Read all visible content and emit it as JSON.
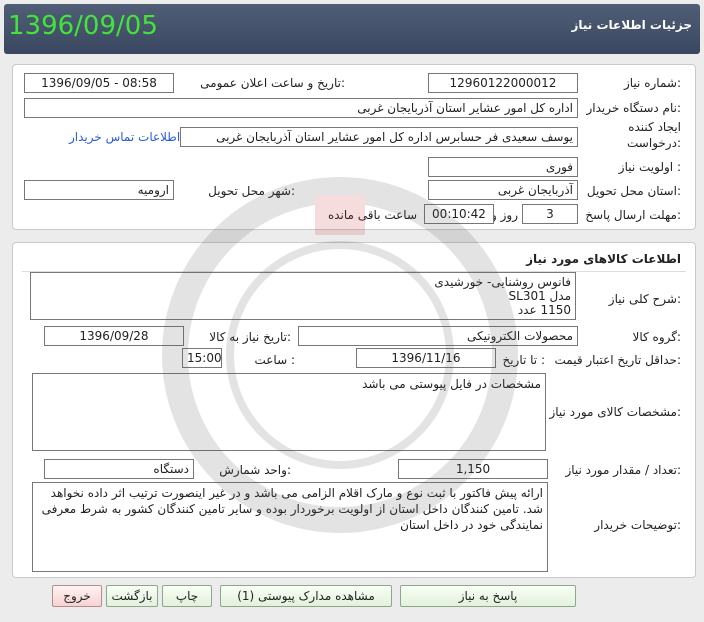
{
  "header": {
    "title": "جزئیات اطلاعات نیاز",
    "date": "1396/09/05"
  },
  "need_info": {
    "need_number_label": "شماره نیاز:",
    "need_number": "12960122000012",
    "announce_label": "تاریخ و ساعت اعلان عمومی:",
    "announce_value": "1396/09/05 - 08:58",
    "buyer_org_label": "نام دستگاه خریدار:",
    "buyer_org": "اداره کل امور عشایر استان آذربایجان غربی",
    "requester_label_1": "ایجاد کننده",
    "requester_label_2": "درخواست:",
    "requester": "یوسف سعیدی فر حسابرس اداره کل امور عشایر استان آذربایجان غربی",
    "contact_link": "اطلاعات تماس خریدار",
    "priority_label": "اولویت نیاز :",
    "priority": "فوری",
    "province_label": "استان محل تحویل:",
    "province": "آذربایجان غربی",
    "city_label": "شهر محل تحویل:",
    "city": "ارومیه",
    "deadline_label": "مهلت ارسال پاسخ:",
    "days": "3",
    "days_label": "روز و",
    "time_left": "00:10:42",
    "time_left_label": "ساعت باقی مانده"
  },
  "goods": {
    "section_title": "اطلاعات کالاهای مورد نیاز",
    "description_label": "شرح کلی نیاز:",
    "description_lines": [
      "فانوس روشنایی-   خورشیدی",
      "مدل SL301",
      "1150 عدد"
    ],
    "group_label": "گروه کالا:",
    "group": "محصولات الکترونیکی",
    "need_date_label": "تاریخ نیاز به کالا:",
    "need_date": "1396/09/28",
    "price_validity_label": "حداقل تاریخ اعتبار قیمت:",
    "until_date_label": "تا تاریخ :",
    "until_date": "1396/11/16",
    "hour_label": "ساعت :",
    "hour": "15:00",
    "specs_label": "مشخصات کالای مورد نیاز:",
    "specs": "مشخصات در فایل پیوستی می باشد",
    "quantity_label": "تعداد / مقدار مورد نیاز:",
    "quantity": "1,150",
    "unit_label": "واحد شمارش:",
    "unit": "دستگاه",
    "buyer_notes_label": "توضیحات خریدار:",
    "buyer_notes": "ارائه پیش فاکتور با ثبت نوع و مارک اقلام  الزامی می باشد و در غیر اینصورت ترتیب اثر داده نخواهد شد. تامین کنندگان داخل استان از اولویت برخوردار بوده و سایر تامین کنندگان کشور  به شرط معرفی نمایندگی خود در  داخل استان"
  },
  "buttons": {
    "reply": "پاسخ به نیاز",
    "attachments": "مشاهده مدارک پیوستی (1)",
    "print": "چاپ",
    "back": "بازگشت",
    "exit": "خروج"
  },
  "colors": {
    "header_bg": "#46546c",
    "date_green": "#43e33a",
    "link_blue": "#2a5bd8"
  }
}
